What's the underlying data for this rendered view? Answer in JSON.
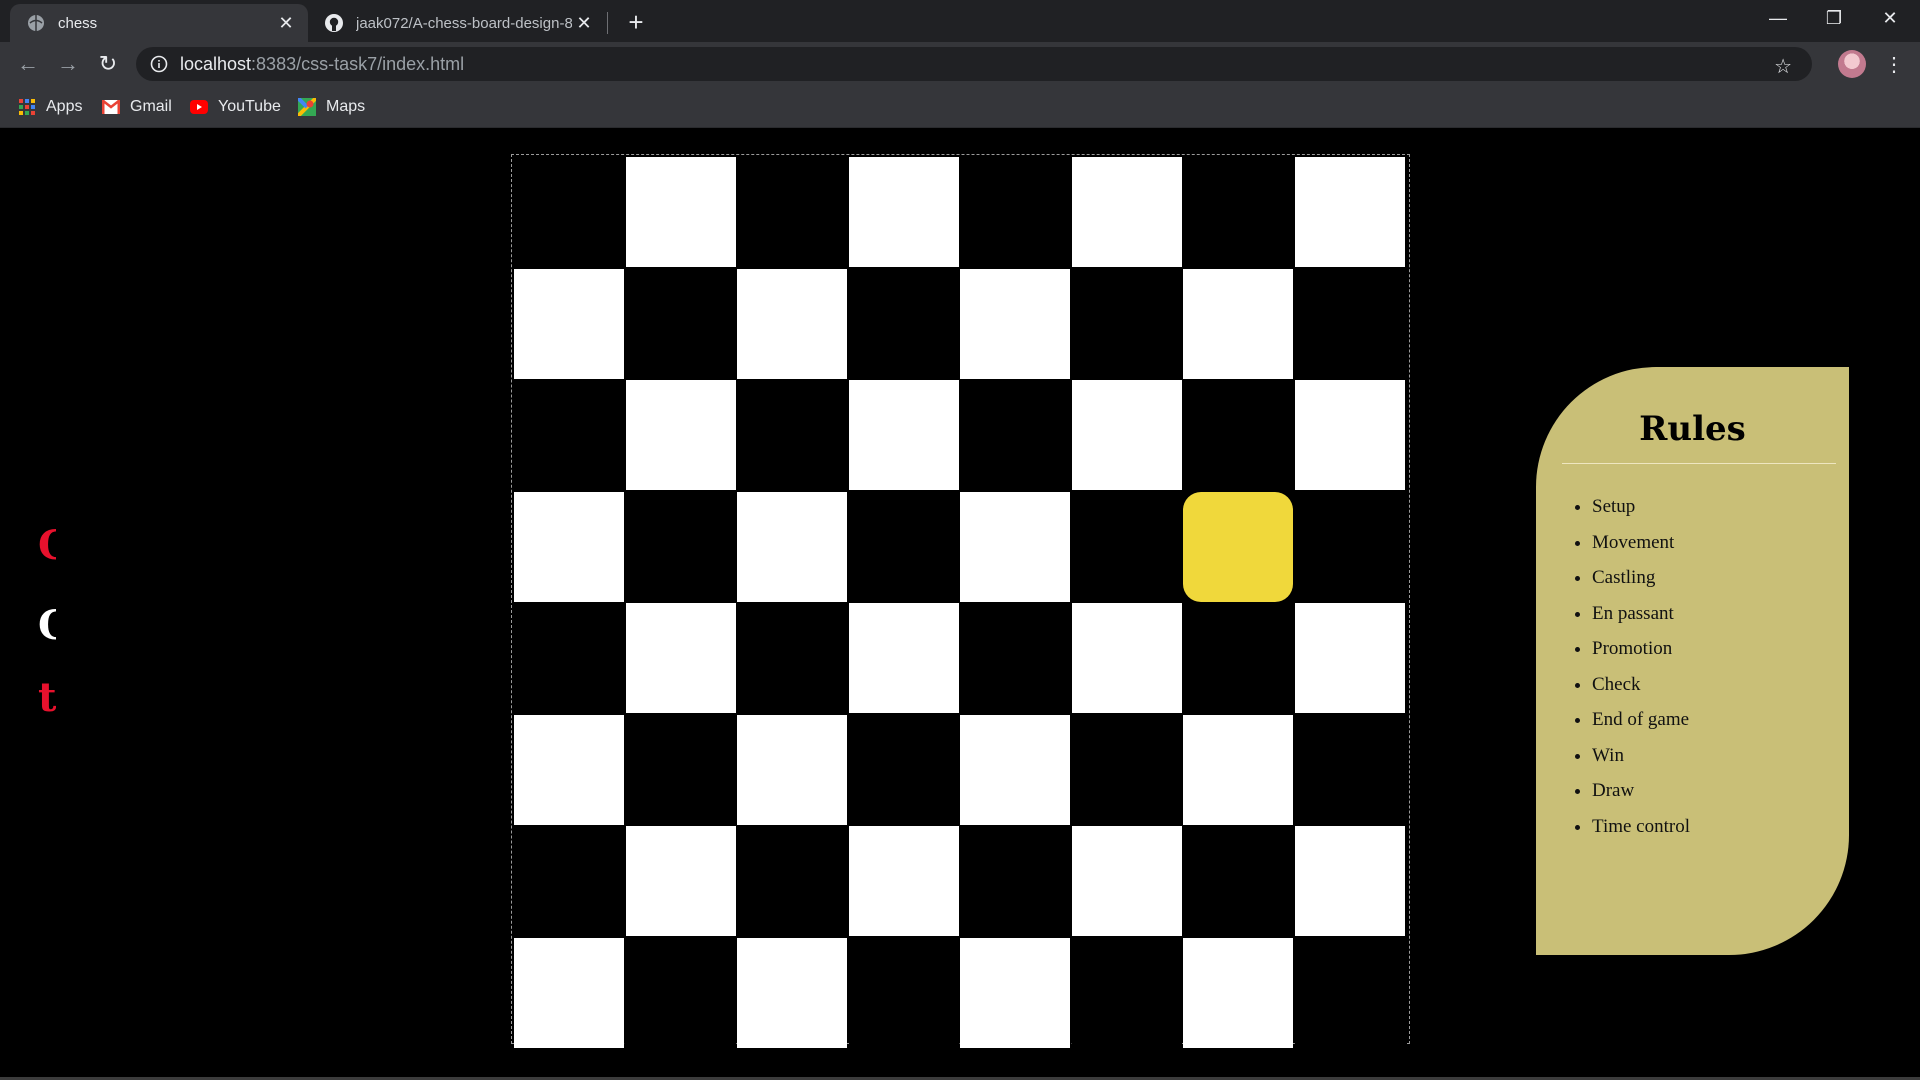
{
  "browser": {
    "tabs": [
      {
        "title": "chess",
        "icon": "globe-icon",
        "active": true
      },
      {
        "title": "jaak072/A-chess-board-design-8",
        "icon": "github-icon",
        "active": false
      }
    ],
    "address": {
      "host": "localhost",
      "rest": ":8383/css-task7/index.html"
    },
    "bookmarks": [
      {
        "label": "Apps",
        "icon": "apps-grid-icon"
      },
      {
        "label": "Gmail",
        "icon": "gmail-icon"
      },
      {
        "label": "YouTube",
        "icon": "youtube-icon"
      },
      {
        "label": "Maps",
        "icon": "maps-icon"
      }
    ]
  },
  "page": {
    "side_letters": [
      {
        "char": "C",
        "color": "#e8112d"
      },
      {
        "char": "C",
        "color": "#ffffff"
      },
      {
        "char": "t",
        "color": "#e8112d"
      }
    ],
    "board": {
      "size": 8,
      "colors": {
        "light": "#ffffff",
        "dark": "#000000",
        "highlight": "#f0d83b"
      },
      "highlight_square": {
        "row": 4,
        "col": 7
      }
    },
    "rules": {
      "title": "Rules",
      "items": [
        "Setup",
        "Movement",
        "Castling",
        "En passant",
        "Promotion",
        "Check",
        "End of game",
        "Win",
        "Draw",
        "Time control"
      ],
      "background": "#c9bf77"
    }
  }
}
